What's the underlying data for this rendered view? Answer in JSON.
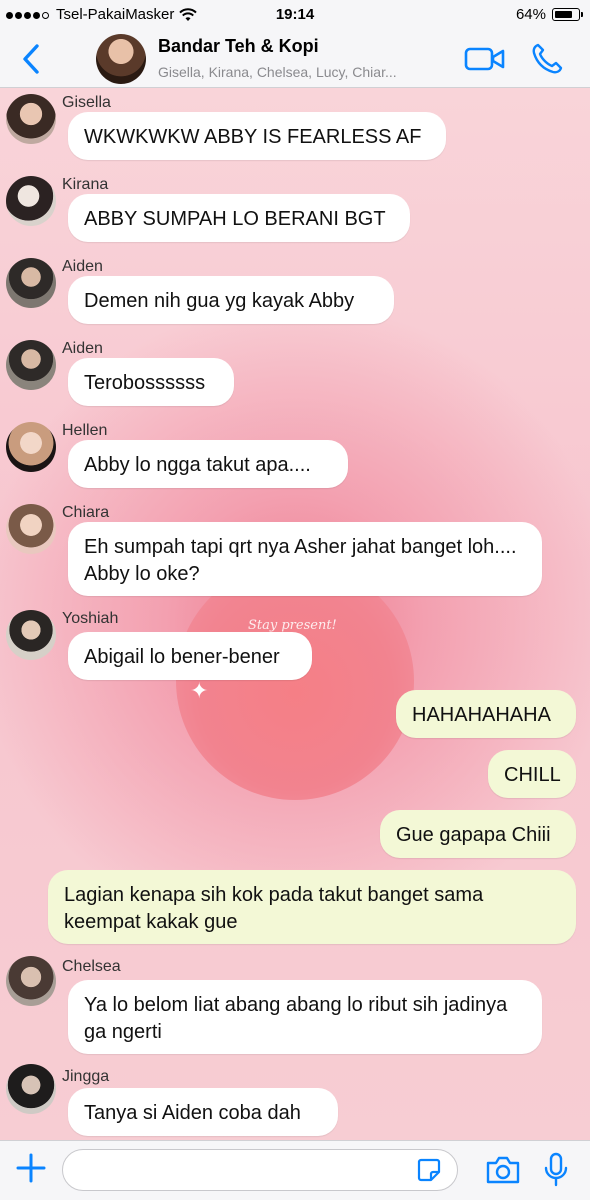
{
  "status": {
    "carrier": "Tsel-PakaiMasker",
    "time": "19:14",
    "battery": "64%",
    "battery_level": 0.64
  },
  "header": {
    "title": "Bandar Teh & Kopi",
    "members": "Gisella, Kirana, Chelsea, Lucy, Chiar...",
    "icons": {
      "back": "chevron-left-icon",
      "video": "video-camera-icon",
      "call": "phone-icon"
    },
    "accent": "#0a84ff"
  },
  "watermark": "Stay present!",
  "messages": [
    {
      "sender": "Gisella",
      "text": "WKWKWKW ABBY IS FEARLESS AF"
    },
    {
      "sender": "Kirana",
      "text": "ABBY SUMPAH LO BERANI BGT"
    },
    {
      "sender": "Aiden",
      "text": "Demen nih gua yg kayak Abby"
    },
    {
      "sender": "Aiden",
      "text": "Terobossssss"
    },
    {
      "sender": "Hellen",
      "text": "Abby lo ngga takut apa...."
    },
    {
      "sender": "Chiara",
      "text": "Eh sumpah tapi qrt nya Asher jahat banget loh.... Abby lo oke?"
    },
    {
      "sender": "Yoshiah",
      "text": "Abigail lo bener-bener"
    },
    {
      "sender": "me",
      "text": "HAHAHAHAHA"
    },
    {
      "sender": "me",
      "text": "CHILL"
    },
    {
      "sender": "me",
      "text": "Gue gapapa Chiii"
    },
    {
      "sender": "me",
      "text": "Lagian kenapa sih kok pada takut banget sama keempat kakak gue"
    },
    {
      "sender": "Chelsea",
      "text": "Ya lo belom liat abang abang lo ribut sih jadinya ga ngerti"
    },
    {
      "sender": "Jingga",
      "text": "Tanya si Aiden coba dah"
    }
  ],
  "composer": {
    "value": "",
    "icons": {
      "add": "plus-icon",
      "sticker": "sticker-icon",
      "camera": "camera-icon",
      "mic": "microphone-icon"
    }
  },
  "colors": {
    "incoming_bubble": "#ffffff",
    "outgoing_bubble": "#f3f8d6",
    "chat_background": "#f7c6cf"
  }
}
